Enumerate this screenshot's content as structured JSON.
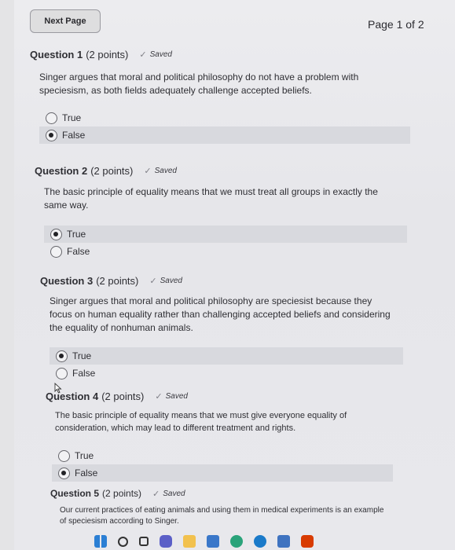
{
  "nav": {
    "next_label": "Next Page",
    "page_indicator": "Page 1 of 2"
  },
  "saved_label": "Saved",
  "questions": [
    {
      "title": "Question 1",
      "points": "(2 points)",
      "text": "Singer argues that moral and political philosophy do not have a problem with speciesism, as both fields adequately challenge accepted beliefs.",
      "options": [
        {
          "label": "True",
          "selected": false
        },
        {
          "label": "False",
          "selected": true
        }
      ]
    },
    {
      "title": "Question 2",
      "points": "(2 points)",
      "text": "The basic principle of equality means that we must treat all groups in exactly the same way.",
      "options": [
        {
          "label": "True",
          "selected": true
        },
        {
          "label": "False",
          "selected": false
        }
      ]
    },
    {
      "title": "Question 3",
      "points": "(2 points)",
      "text": "Singer argues that moral and political philosophy are speciesist because they focus on human equality rather than challenging accepted beliefs and considering the equality of nonhuman animals.",
      "options": [
        {
          "label": "True",
          "selected": true
        },
        {
          "label": "False",
          "selected": false
        }
      ]
    },
    {
      "title": "Question 4",
      "points": "(2 points)",
      "text": "The basic principle of equality means that we must give everyone equality of consideration, which may lead to different treatment and rights.",
      "options": [
        {
          "label": "True",
          "selected": false
        },
        {
          "label": "False",
          "selected": true
        }
      ]
    },
    {
      "title": "Question 5",
      "points": "(2 points)",
      "text": "Our current practices of eating animals and using them in medical experiments is an example of speciesism according to Singer.",
      "options": []
    }
  ],
  "taskbar_icons": [
    "windows-icon",
    "search-icon",
    "task-view-icon",
    "teams-icon",
    "file-explorer-icon",
    "store-icon",
    "edge-icon",
    "dell-icon",
    "photos-icon",
    "office-icon"
  ]
}
